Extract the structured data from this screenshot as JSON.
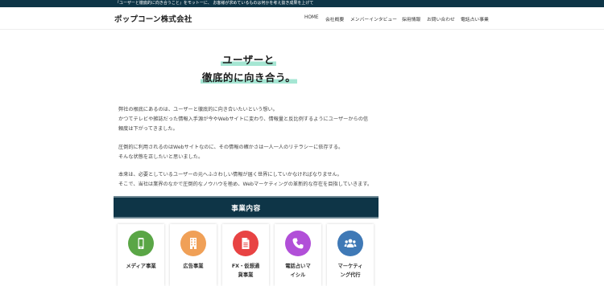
{
  "topbar": {
    "tagline": "『ユーザーと徹底的に向き合うこと』をモットーに、 お客様が求めているものは何かを考え抜き成果を上げて",
    "icons": [
      "rss-icon",
      "search-icon"
    ]
  },
  "header": {
    "logo": "ポップコーン株式会社",
    "nav": [
      "HOME",
      "会社概要",
      "メンバーインタビュー",
      "採用情報",
      "お問い合わせ",
      "電話占い事業"
    ]
  },
  "hero": {
    "line1": "ユーザーと",
    "line2": "徹底的に向き合う。",
    "highlight_color": "#a5e6d3"
  },
  "body": {
    "p1": [
      "弊社の根底にあるのは、ユーザーと徹底的に向き合いたいという想い。",
      "かつてテレビや雑誌だった情報入手源が今やWebサイトに変わり、情報量と反比例するようにユーザーからの信",
      "頼度は下がってきました。"
    ],
    "p2": [
      "圧倒的に利用されるのはWebサイトなのに、その情報の確かさは一人一人のリテラシーに依存する。",
      "そんな状態を正したいと思いました。"
    ],
    "p3": [
      "本来は、必要としているユーザーの元へふさわしい情報が届く世界にしていかなければなりません。",
      "そこで、当社は業界のなかで圧倒的なノウハウを極め、Webマーケティングの革新的な存在を目指していきます。"
    ]
  },
  "services": {
    "title": "事業内容",
    "band_color": "#0e3547",
    "items": [
      {
        "label_lines": [
          "メディア事業"
        ],
        "color": "#5aa646",
        "icon": "smartphone-icon"
      },
      {
        "label_lines": [
          "広告事業"
        ],
        "color": "#f0a057",
        "icon": "building-icon"
      },
      {
        "label_lines": [
          "FX・仮想通",
          "貨事業"
        ],
        "color": "#e84343",
        "icon": "document-icon"
      },
      {
        "label_lines": [
          "電話占いマ",
          "イシル"
        ],
        "color": "#b14fd8",
        "icon": "phone-icon"
      },
      {
        "label_lines": [
          "マーケティ",
          "ング代行"
        ],
        "color": "#3f79b6",
        "icon": "users-icon"
      }
    ]
  }
}
